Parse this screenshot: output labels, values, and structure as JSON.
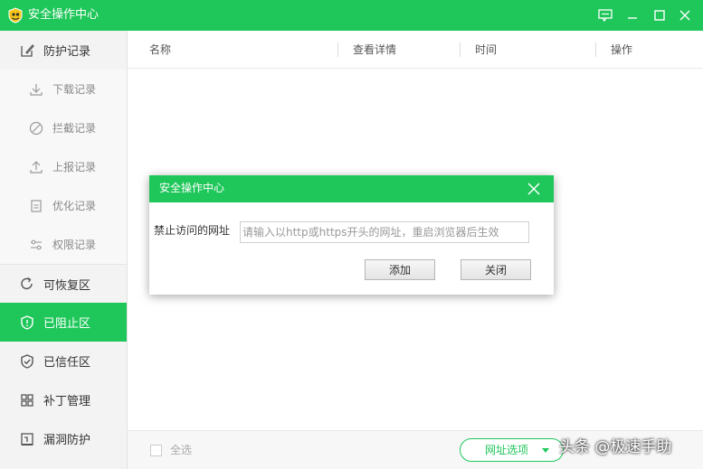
{
  "window": {
    "title": "安全操作中心",
    "logo_icon": "shield-logo-icon",
    "controls": [
      "feedback-icon",
      "minimize-icon",
      "maximize-icon",
      "close-icon"
    ]
  },
  "sidebar": {
    "items": [
      {
        "label": "防护记录",
        "icon": "edit-icon",
        "level": "main",
        "state": "expanded"
      },
      {
        "label": "下载记录",
        "icon": "download-icon",
        "level": "sub"
      },
      {
        "label": "拦截记录",
        "icon": "block-icon",
        "level": "sub"
      },
      {
        "label": "上报记录",
        "icon": "upload-icon",
        "level": "sub"
      },
      {
        "label": "优化记录",
        "icon": "clipboard-icon",
        "level": "sub"
      },
      {
        "label": "权限记录",
        "icon": "sliders-icon",
        "level": "sub"
      },
      {
        "label": "可恢复区",
        "icon": "refresh-icon",
        "level": "main"
      },
      {
        "label": "已阻止区",
        "icon": "shield-alert-icon",
        "level": "main",
        "state": "active"
      },
      {
        "label": "已信任区",
        "icon": "shield-check-icon",
        "level": "main"
      },
      {
        "label": "补丁管理",
        "icon": "grid-icon",
        "level": "main"
      },
      {
        "label": "漏洞防护",
        "icon": "bug-shield-icon",
        "level": "main"
      }
    ]
  },
  "table": {
    "columns": [
      "名称",
      "查看详情",
      "时间",
      "操作"
    ],
    "rows": []
  },
  "footer": {
    "select_all": "全选",
    "url_options": "网址选项"
  },
  "dialog": {
    "title": "安全操作中心",
    "field_label": "禁止访问的网址",
    "placeholder": "请输入以http或https开头的网址，重启浏览器后生效",
    "add_button": "添加",
    "close_button": "关闭"
  },
  "watermark": "头条 @极速手助",
  "colors": {
    "accent": "#1fc75a",
    "sidebar_bg": "#f3f3f3"
  }
}
